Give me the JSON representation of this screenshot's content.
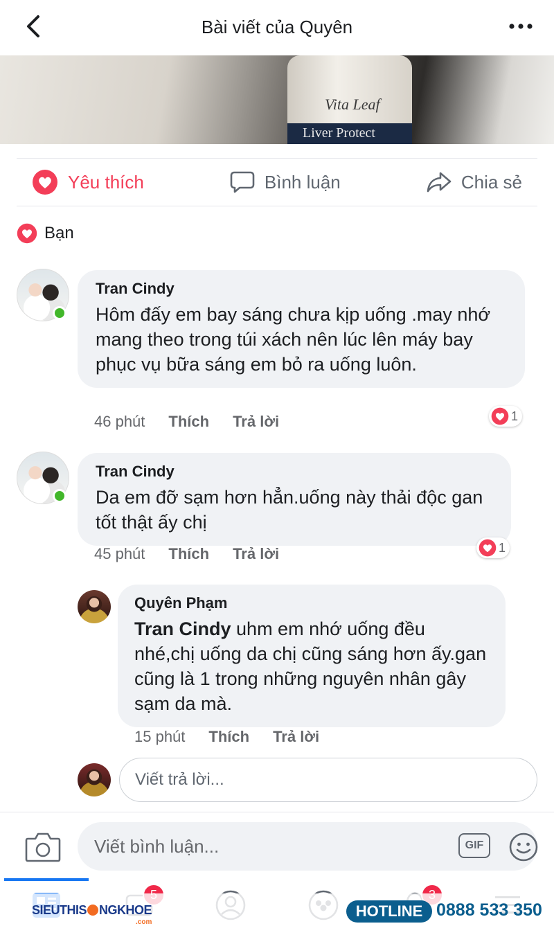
{
  "header": {
    "title": "Bài viết của Quyên"
  },
  "post_image": {
    "brand": "Vita Leaf",
    "product": "Liver Protect"
  },
  "actions": {
    "like": "Yêu thích",
    "comment": "Bình luận",
    "share": "Chia sẻ"
  },
  "reactions": {
    "text": "Bạn"
  },
  "comments": [
    {
      "author": "Tran Cindy",
      "text": "Hôm đấy em bay sáng  chưa kịp uống .may nhớ mang theo trong túi xách nên lúc lên máy bay phục vụ bữa sáng em bỏ ra uống luôn.",
      "time": "46 phút",
      "like": "Thích",
      "reply": "Trả lời",
      "reaction_count": "1"
    },
    {
      "author": "Tran Cindy",
      "text": "Da em đỡ sạm hơn hẳn.uống này thải độc gan tốt thật ấy chị",
      "time": "45 phút",
      "like": "Thích",
      "reply": "Trả lời",
      "reaction_count": "1"
    }
  ],
  "reply": {
    "author": "Quyên Phạm",
    "mention": "Tran Cindy",
    "text": " uhm em nhớ uống đều nhé,chị uống da chị cũng sáng hơn ấy.gan cũng là 1 trong những nguyên nhân gây sạm da mà.",
    "time": "15 phút",
    "like": "Thích",
    "reply": "Trả lời"
  },
  "reply_input": {
    "placeholder": "Viết trả lời..."
  },
  "comment_bar": {
    "placeholder": "Viết bình luận...",
    "gif": "GIF"
  },
  "tab_badges": {
    "messages": "5",
    "notifications": "3"
  },
  "watermark": {
    "brand_left": "SIEUTHIS",
    "brand_right": "NGKHOE",
    "brand_sub": ".com",
    "hotline_label": "HOTLINE",
    "hotline_number": "0888 533 350"
  },
  "colors": {
    "like_red": "#f33e58",
    "fb_blue": "#1877f2",
    "bubble_gray": "#f0f2f5",
    "online_green": "#42b72a",
    "hotline_blue": "#0b5e8e"
  }
}
